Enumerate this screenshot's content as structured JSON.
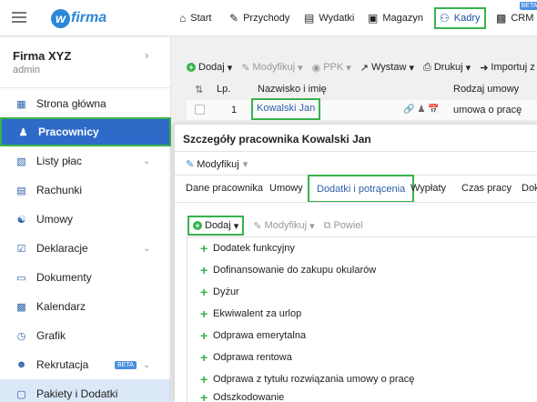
{
  "app": {
    "logo_text": "firma",
    "logo_letter": "w"
  },
  "topnav": {
    "items": [
      {
        "label": "Start",
        "icon": "home-icon"
      },
      {
        "label": "Przychody",
        "icon": "income-icon"
      },
      {
        "label": "Wydatki",
        "icon": "expenses-icon"
      },
      {
        "label": "Magazyn",
        "icon": "warehouse-icon"
      },
      {
        "label": "Kadry",
        "icon": "people-icon",
        "active": true
      },
      {
        "label": "CRM",
        "icon": "crm-icon",
        "badge": "BETA"
      }
    ]
  },
  "sidebar": {
    "company": "Firma XYZ",
    "user": "admin",
    "items": [
      {
        "label": "Strona główna",
        "icon": "dashboard-icon"
      },
      {
        "label": "Pracownicy",
        "icon": "user-plus-icon",
        "active": true
      },
      {
        "label": "Listy płac",
        "icon": "calculator-icon",
        "chevron": true
      },
      {
        "label": "Rachunki",
        "icon": "receipt-icon"
      },
      {
        "label": "Umowy",
        "icon": "handshake-icon"
      },
      {
        "label": "Deklaracje",
        "icon": "checklist-icon",
        "chevron": true
      },
      {
        "label": "Dokumenty",
        "icon": "document-icon"
      },
      {
        "label": "Kalendarz",
        "icon": "calendar-icon"
      },
      {
        "label": "Grafik",
        "icon": "clock-icon"
      },
      {
        "label": "Rekrutacja",
        "icon": "recruitment-icon",
        "badge": "BETA",
        "chevron": true
      },
      {
        "label": "Pakiety i Dodatki",
        "icon": "package-icon",
        "highlight": true
      }
    ]
  },
  "toolbar": {
    "add": "Dodaj",
    "modify": "Modyfikuj",
    "ppk": "PPK",
    "print_out": "Wystaw",
    "print": "Drukuj",
    "import": "Importuj z pliku"
  },
  "table": {
    "headers": {
      "lp": "Lp.",
      "name": "Nazwisko i imię",
      "contract": "Rodzaj umowy"
    },
    "rows": [
      {
        "lp": "1",
        "name": "Kowalski Jan",
        "contract": "umowa o pracę"
      }
    ]
  },
  "modal": {
    "title": "Szczegóły pracownika Kowalski Jan",
    "modify": "Modyfikuj",
    "tabs": [
      {
        "label": "Dane pracownika"
      },
      {
        "label": "Umowy"
      },
      {
        "label": "Dodatki i potrącenia",
        "active": true
      },
      {
        "label": "Wypłaty"
      },
      {
        "label": "Czas pracy"
      },
      {
        "label": "Dokl"
      }
    ],
    "sub_toolbar": {
      "add": "Dodaj",
      "modify": "Modyfikuj",
      "duplicate": "Powiel"
    },
    "dropdown_items": [
      "Dodatek funkcyjny",
      "Dofinansowanie do zakupu okularów",
      "Dyżur",
      "Ekwiwalent za urlop",
      "Odprawa emerytalna",
      "Odprawa rentowa",
      "Odprawa z tytułu rozwiązania umowy o pracę",
      "Odszkodowanie"
    ]
  }
}
